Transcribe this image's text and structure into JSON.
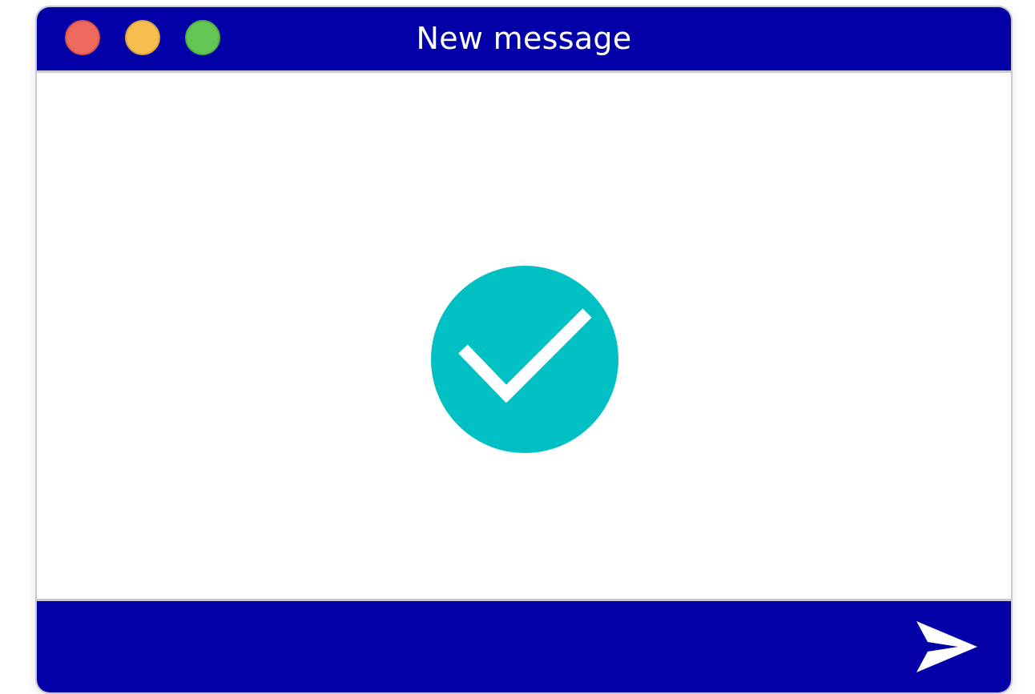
{
  "window": {
    "title": "New message",
    "accent_color": "#0400a8",
    "controls": {
      "close": "close-icon",
      "minimize": "minimize-icon",
      "maximize": "maximize-icon"
    }
  },
  "content": {
    "status_icon": "checkmark-circle-icon",
    "status_color": "#00c0c4"
  },
  "footer": {
    "send_icon": "send-icon"
  }
}
